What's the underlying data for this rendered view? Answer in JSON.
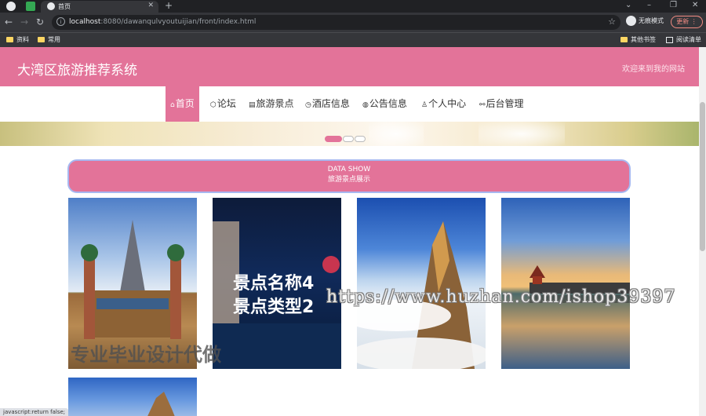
{
  "browser": {
    "tab_title": "首页",
    "url_host": "localhost",
    "url_rest": ":8080/dawanqulvyoutuijian/front/index.html",
    "incognito_label": "无痕模式",
    "update_label": "更新",
    "bookmarks": [
      "资料",
      "常用"
    ],
    "bookmarks_right": [
      "其他书签",
      "阅读清单"
    ]
  },
  "site": {
    "title": "大湾区旅游推荐系统",
    "welcome": "欢迎来到我的网站",
    "nav": [
      {
        "icon": "⌂",
        "label": "首页"
      },
      {
        "icon": "⬡",
        "label": "论坛"
      },
      {
        "icon": "▤",
        "label": "旅游景点"
      },
      {
        "icon": "◷",
        "label": "酒店信息"
      },
      {
        "icon": "◍",
        "label": "公告信息"
      },
      {
        "icon": "♙",
        "label": "个人中心"
      },
      {
        "icon": "⚯",
        "label": "后台管理"
      }
    ]
  },
  "section": {
    "title_en": "DATA SHOW",
    "title_cn": "旅游景点展示"
  },
  "card_overlay": {
    "line1": "景点名称4",
    "line2": "景点类型2"
  },
  "watermarks": {
    "url": "https://www.huzhan.com/ishop39397",
    "cn": "专业毕业设计代做"
  },
  "status_text": "javascript:return false;",
  "colors": {
    "brand": "#e37399",
    "section_border": "#a7b8f0"
  }
}
